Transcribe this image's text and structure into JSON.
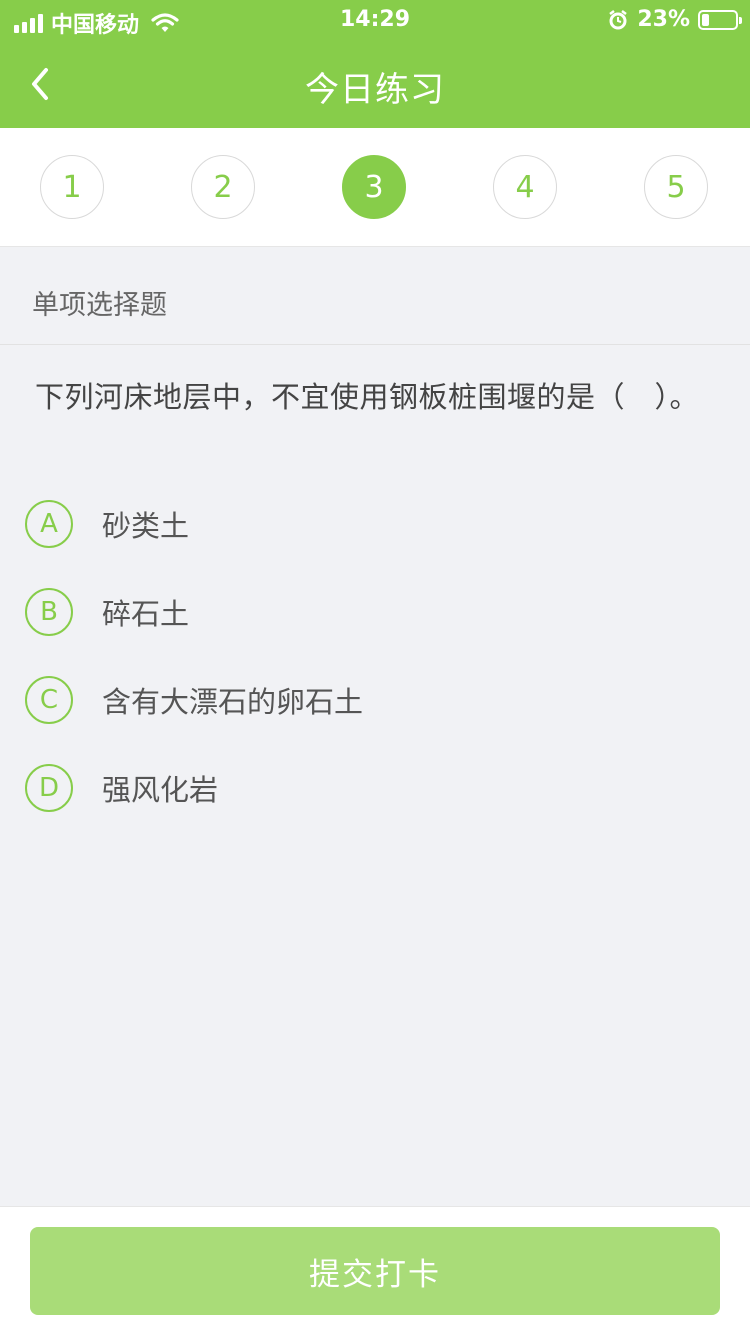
{
  "status_bar": {
    "carrier": "中国移动",
    "time": "14:29",
    "battery": "23%",
    "battery_level": 0.23,
    "icons": [
      "signal-icon",
      "wifi-icon",
      "alarm-icon",
      "battery-icon"
    ]
  },
  "nav": {
    "back_icon": "chevron-left-icon",
    "title": "今日练习"
  },
  "steps": {
    "items": [
      "1",
      "2",
      "3",
      "4",
      "5"
    ],
    "active": 3
  },
  "question": {
    "type": "单项选择题",
    "text": "下列河床地层中，不宜使用钢板桩围堰的是（　）。",
    "options": [
      {
        "key": "A",
        "text": "砂类土"
      },
      {
        "key": "B",
        "text": "碎石土"
      },
      {
        "key": "C",
        "text": "含有大漂石的卵石土"
      },
      {
        "key": "D",
        "text": "强风化岩"
      }
    ]
  },
  "footer": {
    "submit_label": "提交打卡"
  },
  "colors": {
    "accent": "#87cd4a",
    "submit_bg": "#a9dc78",
    "page_bg": "#f1f2f5"
  }
}
